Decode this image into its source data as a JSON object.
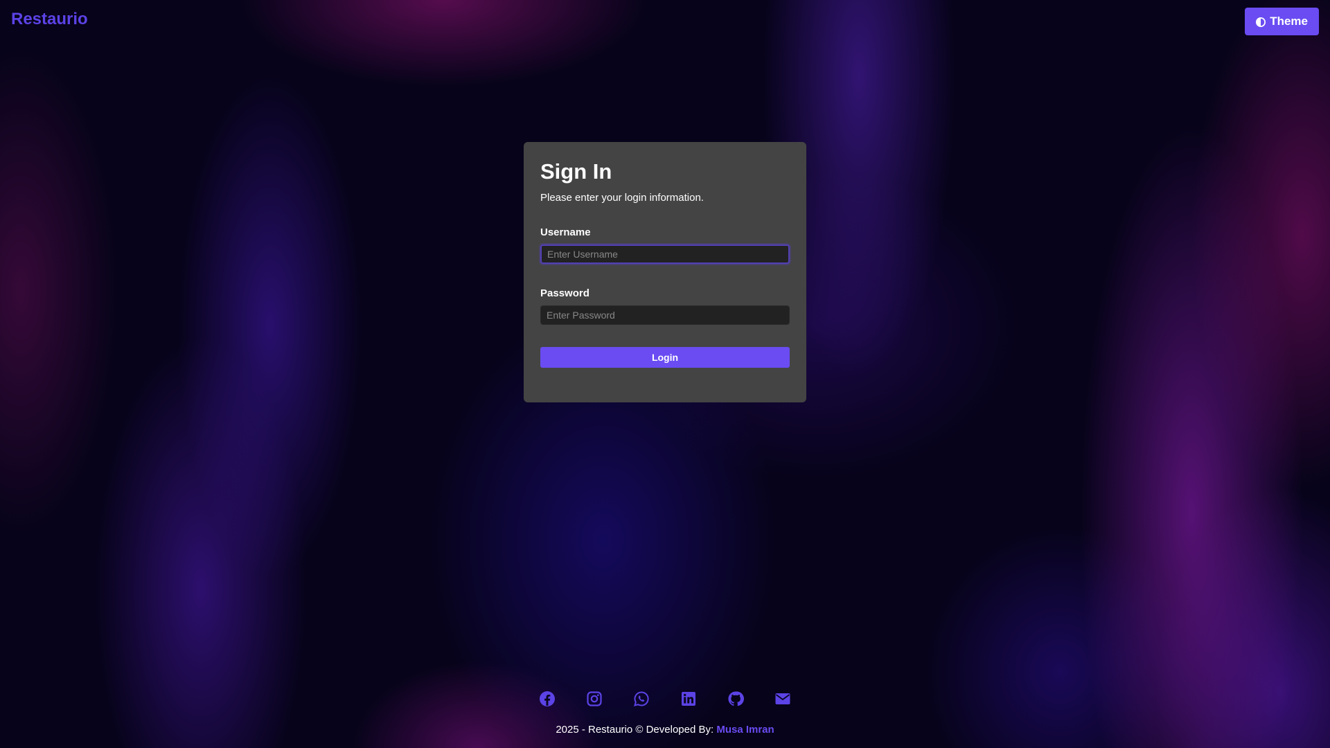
{
  "header": {
    "brand": "Restaurio",
    "theme_label": "Theme"
  },
  "login": {
    "title": "Sign In",
    "subtitle": "Please enter your login information.",
    "username_label": "Username",
    "username_placeholder": "Enter Username",
    "username_value": "",
    "password_label": "Password",
    "password_placeholder": "Enter Password",
    "password_value": "",
    "submit_label": "Login"
  },
  "socials": [
    {
      "name": "facebook-icon"
    },
    {
      "name": "instagram-icon"
    },
    {
      "name": "whatsapp-icon"
    },
    {
      "name": "linkedin-icon"
    },
    {
      "name": "github-icon"
    },
    {
      "name": "email-icon"
    }
  ],
  "footer": {
    "text": "2025 - Restaurio © Developed By: ",
    "author": "Musa Imran"
  },
  "colors": {
    "accent": "#6a4cf2",
    "brand": "#5b43e6",
    "card": "#444444",
    "input": "#222222"
  }
}
